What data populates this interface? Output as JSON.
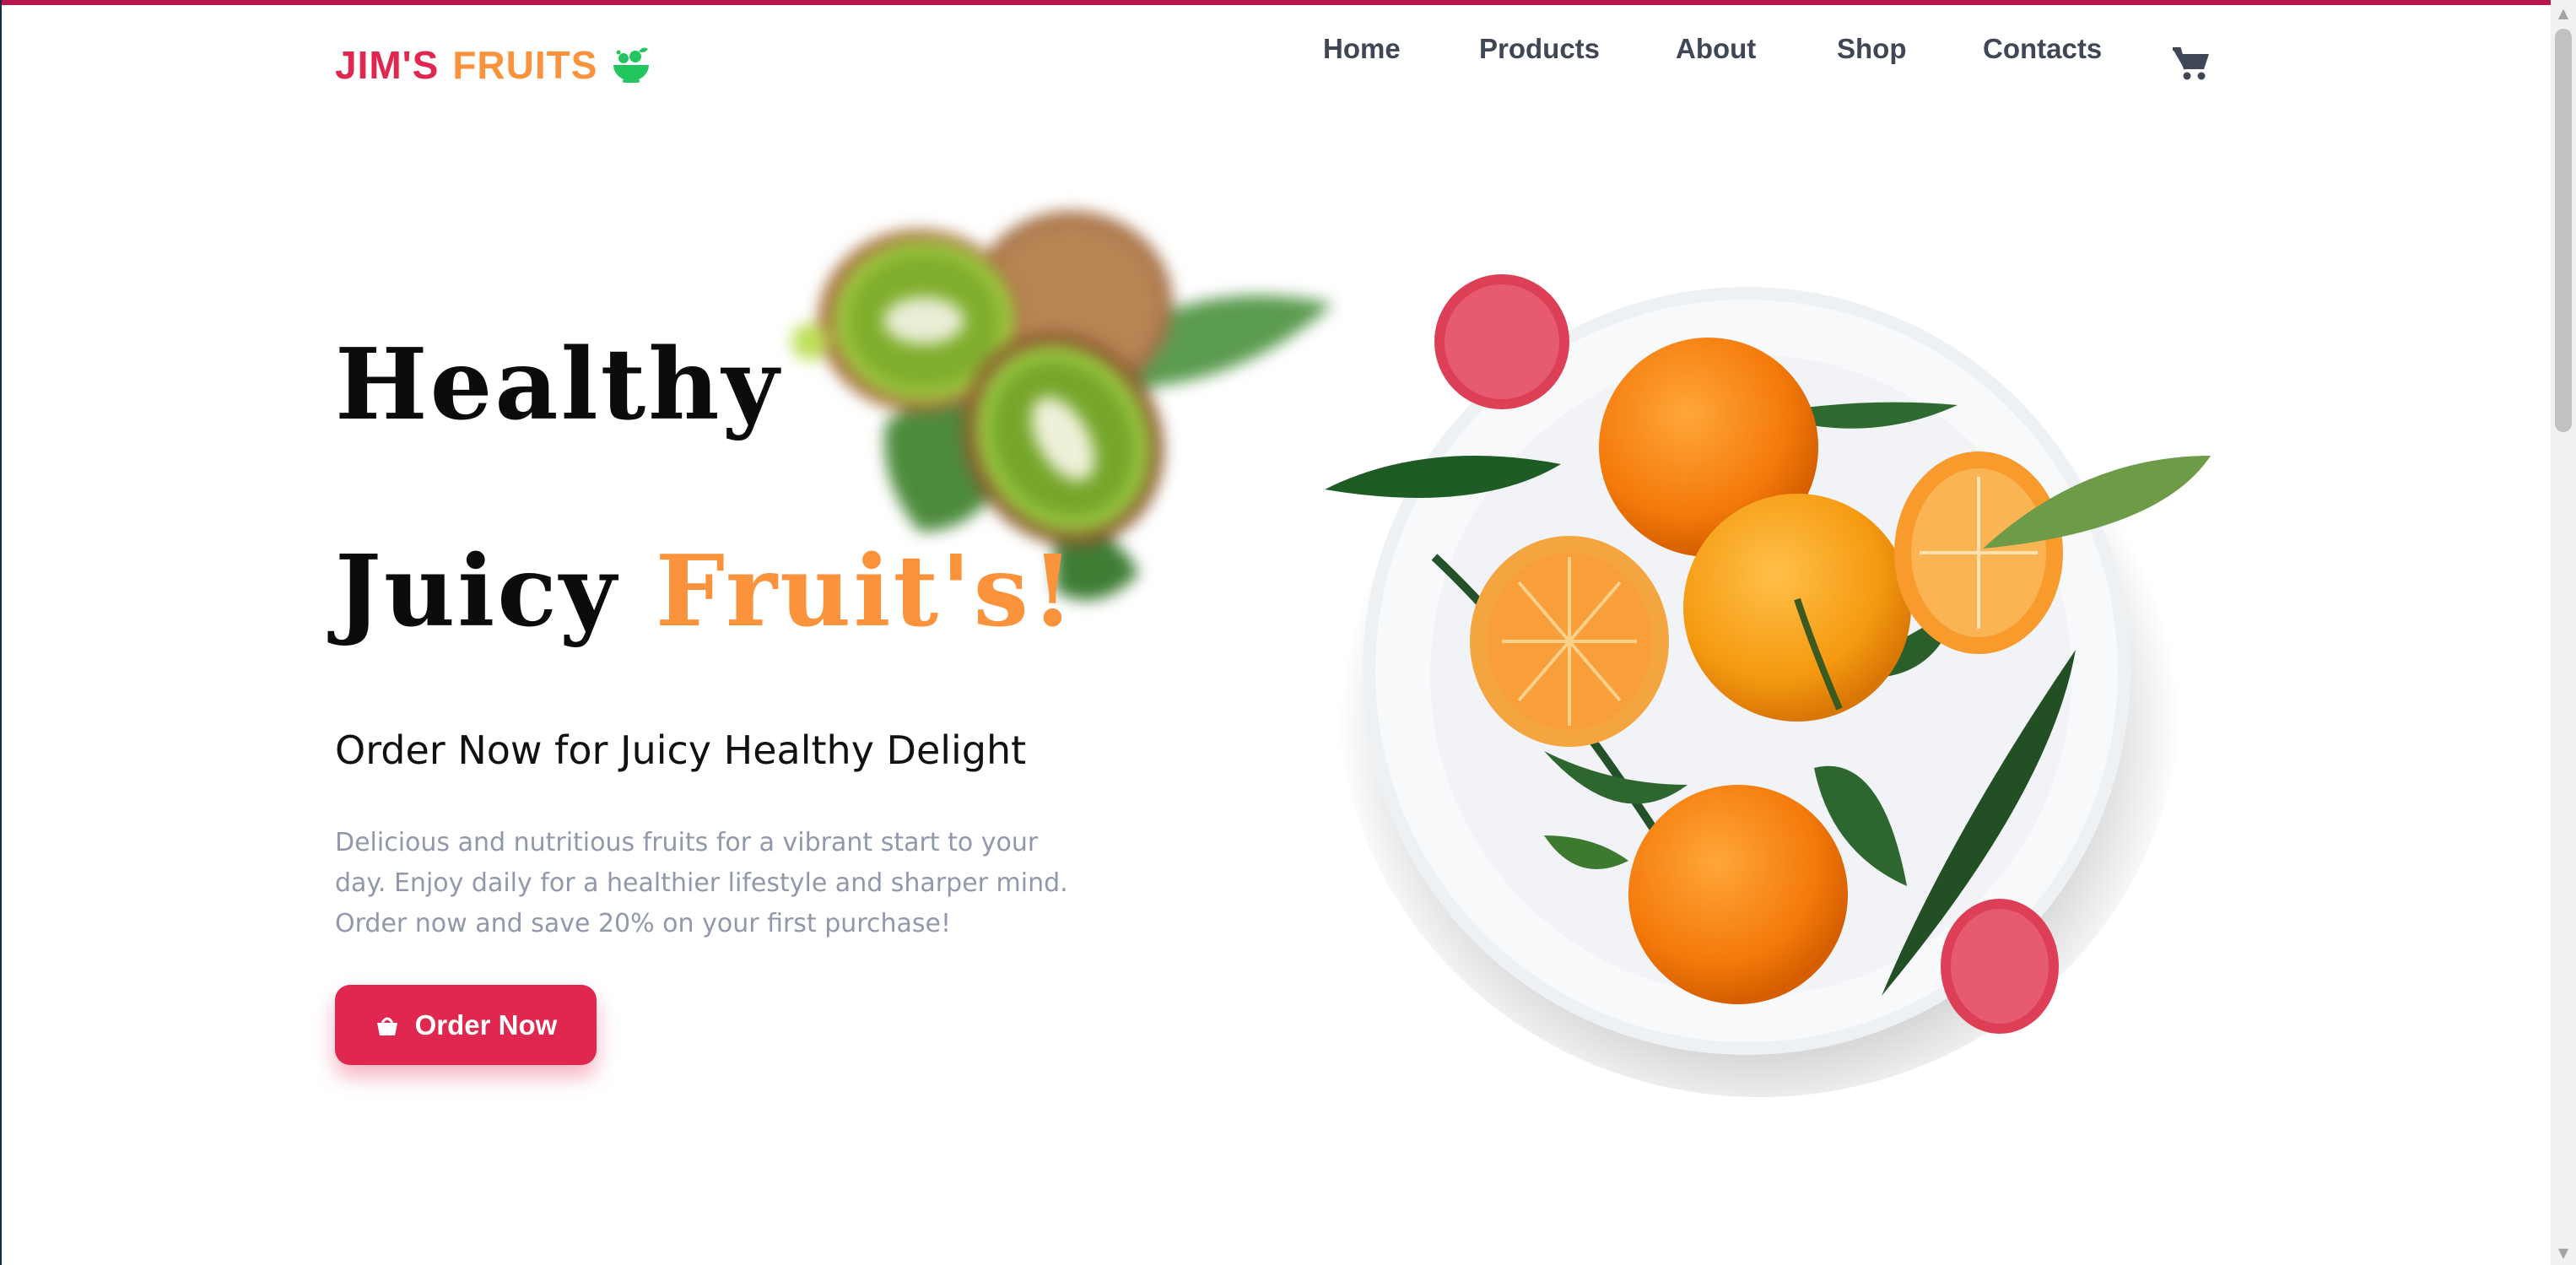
{
  "brand": {
    "part1": "JIM'S",
    "part2": "FRUITS",
    "icon": "fruit-bowl-icon",
    "color_primary": "#e0274f",
    "color_accent": "#fb923c"
  },
  "nav": {
    "items": [
      "Home",
      "Products",
      "About",
      "Shop",
      "Contacts"
    ],
    "cart_icon": "cart-icon"
  },
  "hero": {
    "line1": "Healthy",
    "line2_prefix": "Juicy",
    "line2_accent": "Fruit's!",
    "subtitle": "Order Now for Juicy Healthy Delight",
    "description": "Delicious and nutritious fruits for a vibrant start to your day. Enjoy daily for a healthier lifestyle and sharper mind. Order now and save 20% on your first purchase!",
    "cta_label": "Order Now",
    "cta_icon": "basket-icon"
  },
  "images": {
    "kiwi": "blurred-kiwi-image",
    "plate": "plate-of-tangerines-image"
  }
}
